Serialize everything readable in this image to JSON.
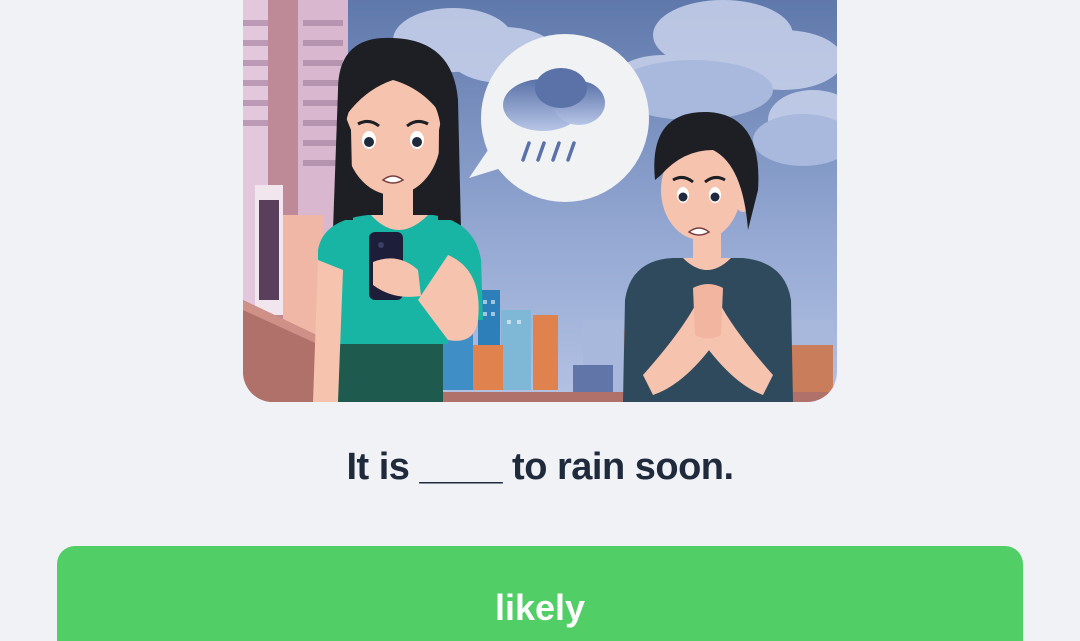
{
  "question": {
    "text": "It is ____ to rain soon."
  },
  "answer_option": {
    "label": "likely"
  },
  "illustration": {
    "icon": "rain-cloud-icon",
    "colors": {
      "sky": "#7d93c4",
      "woman_shirt": "#19b5a4",
      "man_shirt": "#2f4a5c",
      "answer_green": "#51cf66"
    }
  }
}
